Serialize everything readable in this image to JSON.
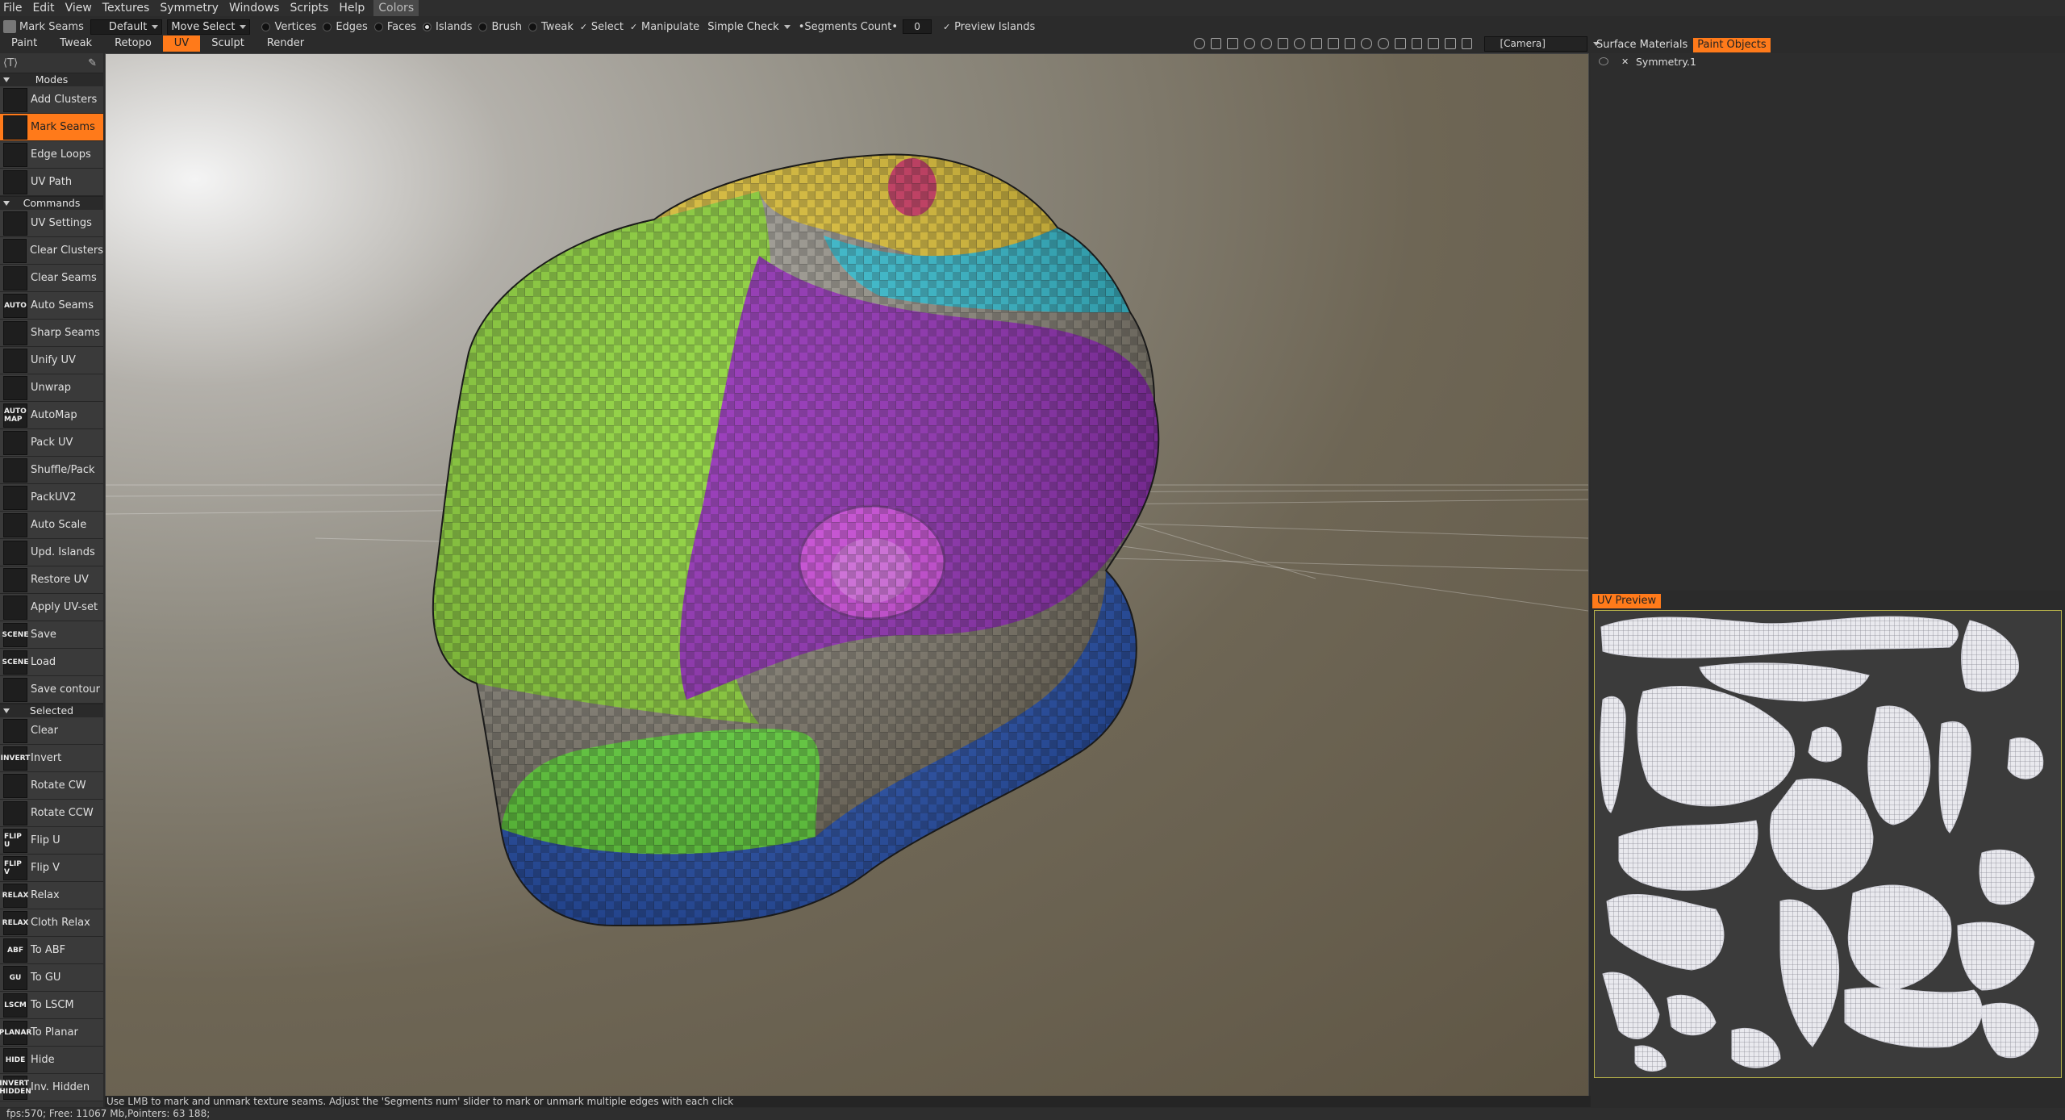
{
  "menu": [
    "File",
    "Edit",
    "View",
    "Textures",
    "Symmetry",
    "Windows",
    "Scripts",
    "Help",
    "Colors"
  ],
  "options": {
    "tool_name": "Mark Seams",
    "preset": "Default",
    "move_mode": "Move Select",
    "vertices": "Vertices",
    "edges": "Edges",
    "faces": "Faces",
    "islands": "Islands",
    "brush": "Brush",
    "tweak": "Tweak",
    "select": "Select",
    "manipulate": "Manipulate",
    "simple_check": "Simple Check",
    "segments_count": "•Segments Count•",
    "segments_value": "0",
    "preview_islands": "Preview Islands"
  },
  "rooms": [
    "Paint",
    "Tweak",
    "Retopo",
    "UV",
    "Sculpt",
    "Render"
  ],
  "active_room": "UV",
  "camera": "[Camera]",
  "left_panel": {
    "modes_header": "Modes",
    "modes": [
      {
        "label": "Add Clusters",
        "icon": "cube-icon",
        "badge": ""
      },
      {
        "label": "Mark Seams",
        "icon": "cube-seam-icon",
        "badge": "",
        "active": true
      },
      {
        "label": "Edge Loops",
        "icon": "edge-loop-icon",
        "badge": ""
      },
      {
        "label": "UV Path",
        "icon": "uv-path-icon",
        "badge": ""
      }
    ],
    "commands_header": "Commands",
    "commands": [
      {
        "label": "UV Settings",
        "icon": "sliders-icon",
        "badge": ""
      },
      {
        "label": "Clear Clusters",
        "icon": "x-icon",
        "badge": ""
      },
      {
        "label": "Clear Seams",
        "icon": "x-icon",
        "badge": ""
      },
      {
        "label": "Auto Seams",
        "icon": "auto-icon",
        "badge": "AUTO"
      },
      {
        "label": "Sharp Seams",
        "icon": "cube-icon",
        "badge": ""
      },
      {
        "label": "Unify UV",
        "icon": "unify-icon",
        "badge": ""
      },
      {
        "label": "Unwrap",
        "icon": "grid-icon",
        "badge": ""
      },
      {
        "label": "AutoMap",
        "icon": "automap-icon",
        "badge": "AUTO MAP"
      },
      {
        "label": "Pack UV",
        "icon": "pack-icon",
        "badge": ""
      },
      {
        "label": "Shuffle/Pack",
        "icon": "shuffle-icon",
        "badge": ""
      },
      {
        "label": "PackUV2",
        "icon": "pack-icon",
        "badge": ""
      },
      {
        "label": "Auto Scale",
        "icon": "auto-scale-icon",
        "badge": ""
      },
      {
        "label": "Upd. Islands",
        "icon": "refresh-icon",
        "badge": ""
      },
      {
        "label": "Restore UV",
        "icon": "restore-icon",
        "badge": ""
      },
      {
        "label": "Apply UV-set",
        "icon": "check-icon",
        "badge": ""
      },
      {
        "label": "Save",
        "icon": "save-icon",
        "badge": "SCENE"
      },
      {
        "label": "Load",
        "icon": "load-icon",
        "badge": "SCENE"
      },
      {
        "label": "Save contour",
        "icon": "contour-icon",
        "badge": ""
      }
    ],
    "selected_header": "Selected",
    "selected": [
      {
        "label": "Clear",
        "icon": "x-icon",
        "badge": ""
      },
      {
        "label": "Invert",
        "icon": "invert-icon",
        "badge": "INVERT"
      },
      {
        "label": "Rotate CW",
        "icon": "rotate-cw-icon",
        "badge": ""
      },
      {
        "label": "Rotate CCW",
        "icon": "rotate-ccw-icon",
        "badge": ""
      },
      {
        "label": "Flip U",
        "icon": "flip-u-icon",
        "badge": "FLIP U"
      },
      {
        "label": "Flip V",
        "icon": "flip-v-icon",
        "badge": "FLIP V"
      },
      {
        "label": "Relax",
        "icon": "relax-icon",
        "badge": "RELAX"
      },
      {
        "label": "Cloth Relax",
        "icon": "relax-icon",
        "badge": "RELAX"
      },
      {
        "label": "To ABF",
        "icon": "abf-icon",
        "badge": "ABF"
      },
      {
        "label": "To GU",
        "icon": "gu-icon",
        "badge": "GU"
      },
      {
        "label": "To LSCM",
        "icon": "lscm-icon",
        "badge": "LSCM"
      },
      {
        "label": "To Planar",
        "icon": "planar-icon",
        "badge": "PLANAR"
      },
      {
        "label": "Hide",
        "icon": "hide-icon",
        "badge": "HIDE"
      },
      {
        "label": "Inv. Hidden",
        "icon": "inv-hidden-icon",
        "badge": "INVERT HIDDEN"
      }
    ]
  },
  "right_panel": {
    "tabs": [
      "Surface Materials",
      "Paint Objects"
    ],
    "active_tab": "Paint Objects",
    "tree": [
      "Symmetry.1"
    ]
  },
  "uv_preview": {
    "title": "UV Preview"
  },
  "hint": "Use LMB to mark and unmark texture seams. Adjust the 'Segments num' slider to mark or unmark multiple edges with each click",
  "status": "fps:570;   Free: 11067 Mb,Pointers: 63 188;",
  "colors": {
    "accent": "#ff7a1a",
    "lime": "#86d32a",
    "purple": "#8a1fb0",
    "blue": "#1f4fb8",
    "yellow": "#e3c22a",
    "cyan": "#27bcd0"
  }
}
